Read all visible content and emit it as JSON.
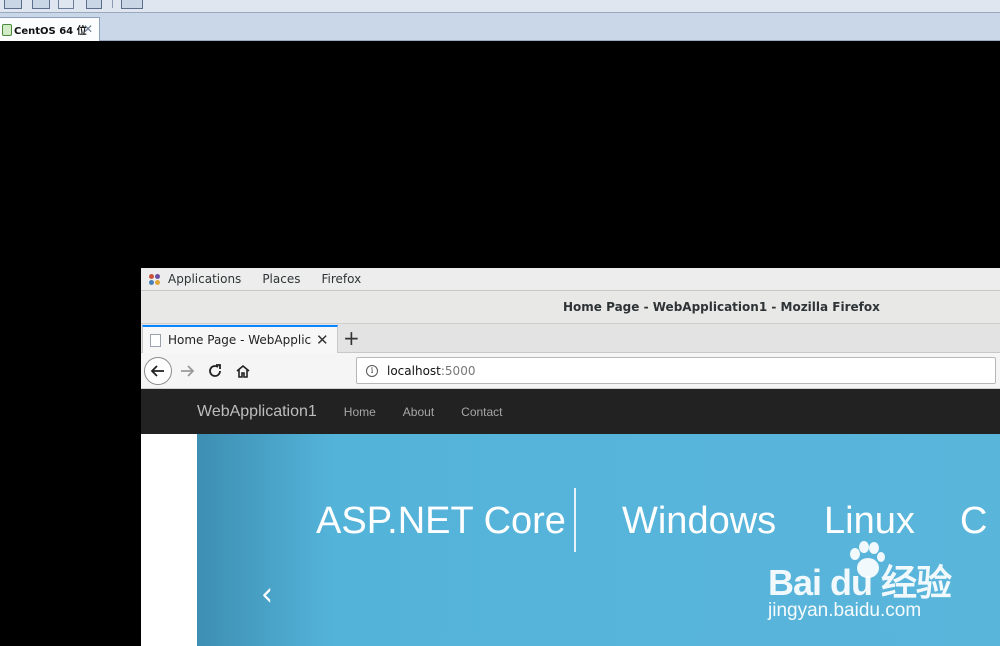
{
  "vm": {
    "tab_label": "CentOS 64 位",
    "tab_close": "✕"
  },
  "gnome": {
    "menu": [
      "Applications",
      "Places",
      "Firefox"
    ]
  },
  "firefox": {
    "window_title": "Home Page - WebApplication1 - Mozilla Firefox",
    "tab_title": "Home Page - WebApplica",
    "tab_close": "✕",
    "new_tab": "+",
    "url_host": "localhost",
    "url_port": ":5000"
  },
  "site": {
    "brand": "WebApplication1",
    "nav": [
      "Home",
      "About",
      "Contact"
    ],
    "carousel": {
      "items": [
        "ASP.NET Core",
        "Windows",
        "Linux",
        "C"
      ],
      "prev_arrow": "‹"
    }
  },
  "watermark": {
    "logo": "Bai du 经验",
    "url": "jingyan.baidu.com"
  },
  "colors": {
    "firefox_accent": "#0a84ff",
    "site_nav_bg": "#222222",
    "carousel_bg": "#5ab5db"
  }
}
